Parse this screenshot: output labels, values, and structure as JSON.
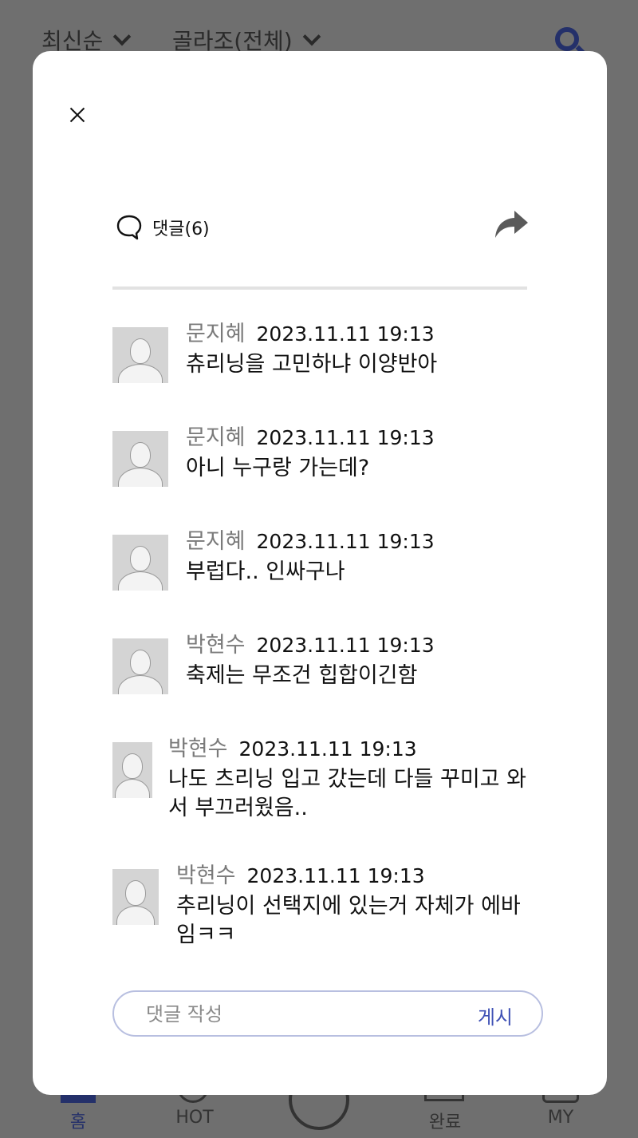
{
  "background": {
    "filters": {
      "sort": "최신순",
      "category": "골라조(전체)"
    },
    "nav": {
      "home": "홈",
      "hot": "HOT",
      "done": "완료",
      "my": "MY"
    }
  },
  "modal": {
    "comment_label": "댓글(6)",
    "comments": [
      {
        "author": "문지혜",
        "time": "2023.11.11 19:13",
        "text": "츄리닝을 고민하냐 이양반아"
      },
      {
        "author": "문지혜",
        "time": "2023.11.11 19:13",
        "text": "아니 누구랑 가는데?"
      },
      {
        "author": "문지혜",
        "time": "2023.11.11 19:13",
        "text": "부럽다.. 인싸구나"
      },
      {
        "author": "박현수",
        "time": "2023.11.11 19:13",
        "text": "축제는 무조건 힙합이긴함"
      },
      {
        "author": "박현수",
        "time": "2023.11.11 19:13",
        "text": "나도 츠리닝 입고 갔는데 다들 꾸미고 와서 부끄러웠음.."
      },
      {
        "author": "박현수",
        "time": "2023.11.11 19:13",
        "text": "추리닝이 선택지에 있는거 자체가 에바임ㅋㅋ"
      }
    ],
    "input": {
      "placeholder": "댓글 작성",
      "value": ""
    },
    "post_label": "게시"
  }
}
